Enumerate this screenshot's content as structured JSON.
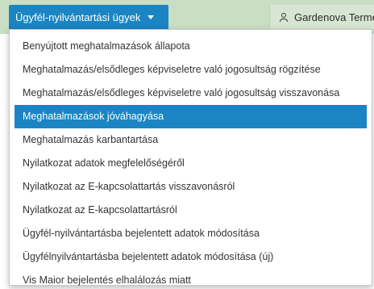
{
  "header": {
    "nav_label": "Ügyfél-nyilvántartási ügyek",
    "user_name": "Gardenova Terme"
  },
  "menu": {
    "items": [
      {
        "label": "Benyújtott meghatalmazások állapota"
      },
      {
        "label": "Meghatalmazás/elsődleges képviseletre való jogosultság rögzítése"
      },
      {
        "label": "Meghatalmazás/elsődleges képviseletre való jogosultság visszavonása"
      },
      {
        "label": "Meghatalmazások jóváhagyása"
      },
      {
        "label": "Meghatalmazás karbantartása"
      },
      {
        "label": "Nyilatkozat adatok megfelelőségéről"
      },
      {
        "label": "Nyilatkozat az E-kapcsolattartás visszavonásról"
      },
      {
        "label": "Nyilatkozat az E-kapcsolattartásról"
      },
      {
        "label": "Ügyfél-nyilvántartásba bejelentett adatok módosítása"
      },
      {
        "label": "Ügyfélnyilvántartásba bejelentett adatok módosítása (új)"
      },
      {
        "label": "Vis Maior bejelentés elhalálozás miatt"
      }
    ],
    "highlighted_index": 3
  },
  "colors": {
    "accent": "#1a85c2",
    "topbar": "#c9dec3"
  },
  "icons": {
    "user": "user-icon",
    "caret": "caret-down-icon"
  }
}
